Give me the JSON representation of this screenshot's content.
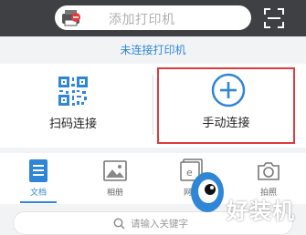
{
  "topbar": {
    "add_printer_label": "添加打印机",
    "printer_icon": "printer-icon",
    "scan_icon": "scan-frame-icon"
  },
  "status": {
    "text": "未连接打印机"
  },
  "connect": {
    "scan": {
      "label": "扫码连接",
      "icon": "qr-code-icon"
    },
    "manual": {
      "label": "手动连接",
      "icon": "plus-circle-icon",
      "highlight_color": "#e0393e"
    }
  },
  "tabs": [
    {
      "label": "文档",
      "icon": "document-icon",
      "active": true
    },
    {
      "label": "相册",
      "icon": "image-icon",
      "active": false
    },
    {
      "label": "网页",
      "icon": "web-icon",
      "active": false
    },
    {
      "label": "拍照",
      "icon": "camera-icon",
      "active": false
    }
  ],
  "search": {
    "placeholder": "请输入关键字"
  },
  "watermark": {
    "text": "好装机"
  },
  "colors": {
    "accent": "#2f86d6",
    "topbar": "#3f4043",
    "highlight": "#e0393e"
  }
}
